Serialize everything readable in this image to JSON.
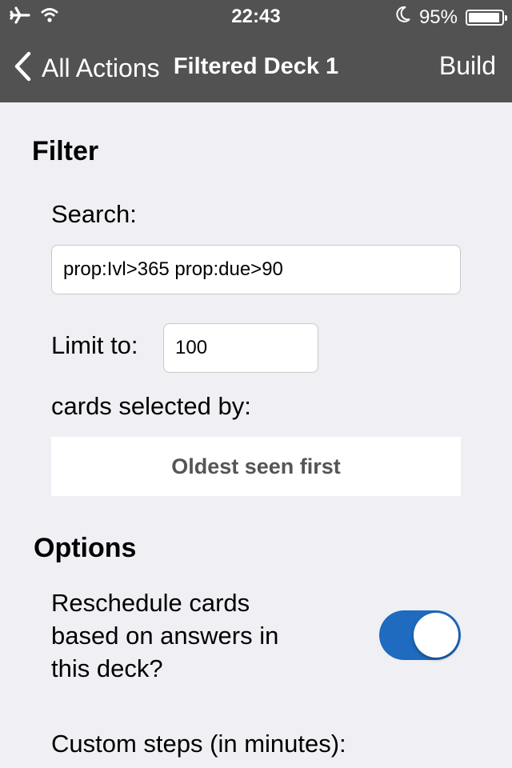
{
  "status_bar": {
    "time": "22:43",
    "battery_text": "95%",
    "battery_level": 0.95,
    "icons": [
      "airplane-icon",
      "wifi-icon",
      "moon-icon",
      "battery-icon"
    ]
  },
  "nav": {
    "back_label": "All Actions",
    "title": "Filtered Deck 1",
    "build_label": "Build"
  },
  "filter": {
    "section_title": "Filter",
    "search_label": "Search:",
    "search_value": "prop:Ivl>365 prop:due>90",
    "limit_label": "Limit to:",
    "limit_value": "100",
    "selected_by_label": "cards selected by:",
    "order_value": "Oldest seen first"
  },
  "options": {
    "section_title": "Options",
    "reschedule_label": "Reschedule cards based on answers in this deck?",
    "reschedule_on": true,
    "custom_steps_label": "Custom steps (in minutes):"
  },
  "colors": {
    "top_bar": "#525252",
    "background": "#efeff4",
    "toggle_on": "#1e6bbf"
  }
}
